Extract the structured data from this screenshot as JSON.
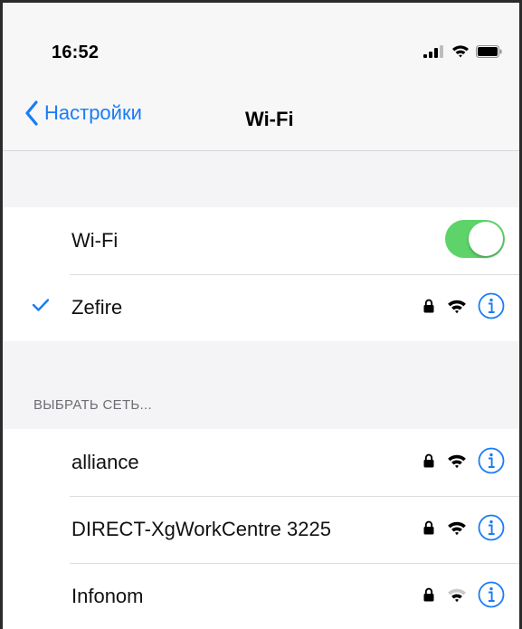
{
  "status_bar": {
    "time": "16:52",
    "icons": [
      "cellular-signal-icon",
      "wifi-signal-icon",
      "battery-icon"
    ]
  },
  "nav": {
    "back_label": "Настройки",
    "title": "Wi-Fi"
  },
  "wifi_toggle": {
    "label": "Wi-Fi",
    "enabled": true,
    "on_color": "#5ed36a"
  },
  "connected_network": {
    "name": "Zefire",
    "secured": true,
    "selected": true
  },
  "section_header": "ВЫБРАТЬ СЕТЬ...",
  "networks": [
    {
      "name": "alliance",
      "secured": true
    },
    {
      "name": "DIRECT-XgWorkCentre 3225",
      "secured": true
    },
    {
      "name": "Infonom",
      "secured": true
    }
  ],
  "colors": {
    "accent": "#1a7cf4",
    "background": "#f4f3f6",
    "secondary_text": "#6d6d72"
  }
}
